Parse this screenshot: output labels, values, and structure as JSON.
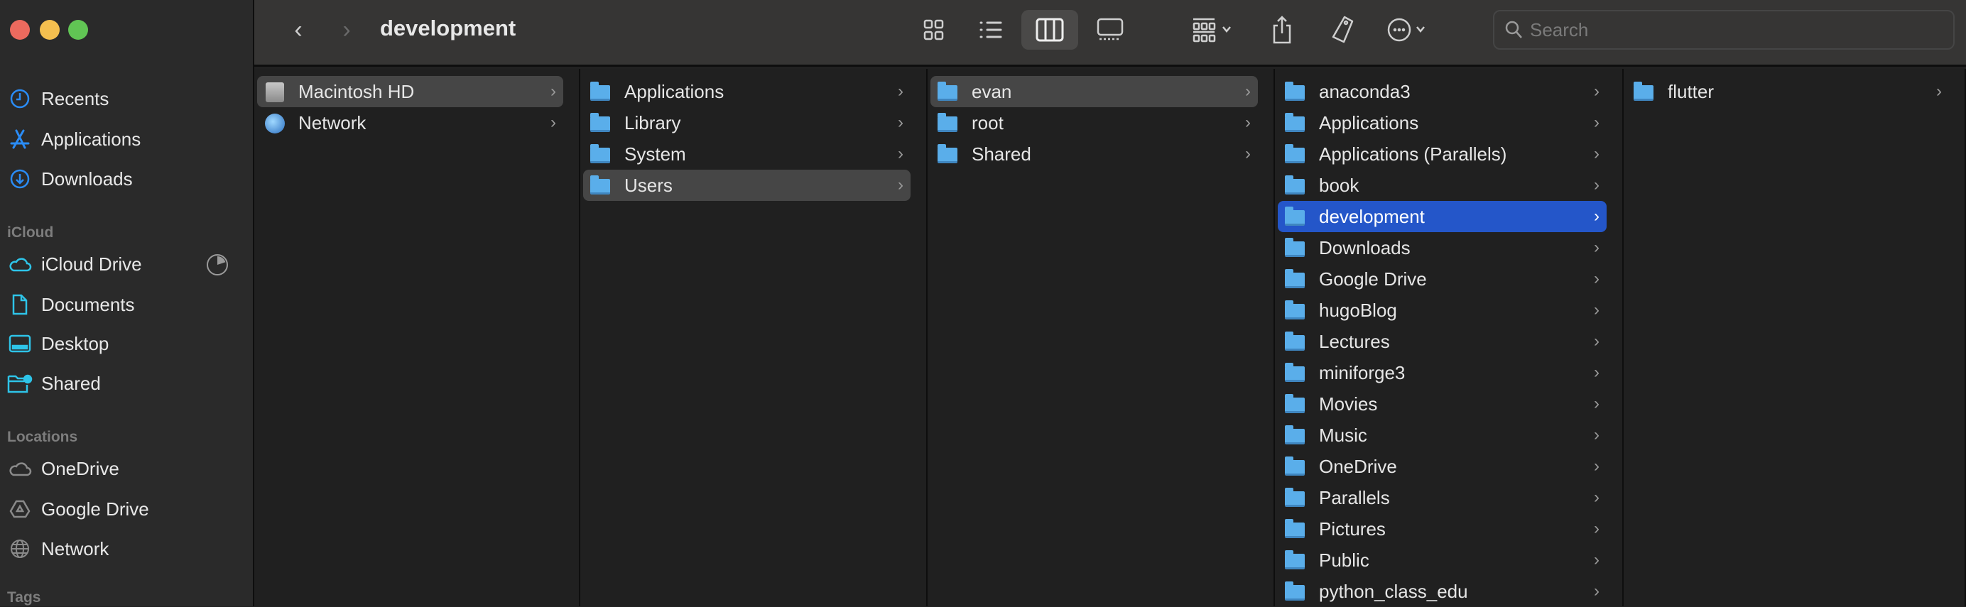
{
  "window": {
    "title": "development",
    "traffic_lights": {
      "close": "#ec6a5e",
      "minimize": "#f4bf4f",
      "zoom": "#61c554"
    }
  },
  "toolbar": {
    "back": "chevron-left",
    "forward": "chevron-right",
    "views": [
      "icon-view",
      "list-view",
      "column-view",
      "gallery-view"
    ],
    "selected_view": "column-view",
    "search_placeholder": "Search",
    "search_value": ""
  },
  "sidebar": {
    "favorites": [
      {
        "label": "Recents",
        "icon": "clock-icon"
      },
      {
        "label": "Applications",
        "icon": "applications-icon"
      },
      {
        "label": "Downloads",
        "icon": "download-icon"
      }
    ],
    "icloud_header": "iCloud",
    "icloud": [
      {
        "label": "iCloud Drive",
        "icon": "cloud-icon"
      },
      {
        "label": "Documents",
        "icon": "document-icon"
      },
      {
        "label": "Desktop",
        "icon": "desktop-icon"
      },
      {
        "label": "Shared",
        "icon": "shared-folder-icon"
      }
    ],
    "locations_header": "Locations",
    "locations": [
      {
        "label": "OneDrive",
        "icon": "cloud-icon"
      },
      {
        "label": "Google Drive",
        "icon": "google-drive-icon"
      },
      {
        "label": "Network",
        "icon": "globe-icon"
      }
    ],
    "tags_header": "Tags",
    "accent": "#2a8cf6",
    "icloud_accent": "#2ec4e8"
  },
  "columns": [
    {
      "items": [
        "Macintosh HD",
        "Network"
      ],
      "selected": 0,
      "selected_style": "gray",
      "icons": [
        "disk",
        "globe"
      ]
    },
    {
      "items": [
        "Applications",
        "Library",
        "System",
        "Users"
      ],
      "selected": 3,
      "selected_style": "gray"
    },
    {
      "items": [
        "evan",
        "root",
        "Shared"
      ],
      "selected": 0,
      "selected_style": "gray"
    },
    {
      "items": [
        "anaconda3",
        "Applications",
        "Applications (Parallels)",
        "book",
        "development",
        "Downloads",
        "Google Drive",
        "hugoBlog",
        "Lectures",
        "miniforge3",
        "Movies",
        "Music",
        "OneDrive",
        "Parallels",
        "Pictures",
        "Public",
        "python_class_edu"
      ],
      "selected": 4,
      "selected_style": "blue"
    },
    {
      "items": [
        "flutter"
      ],
      "selected": -1
    }
  ],
  "colors": {
    "selection_blue": "#2456c9",
    "selection_gray": "#464646",
    "folder": "#5aaeea"
  }
}
